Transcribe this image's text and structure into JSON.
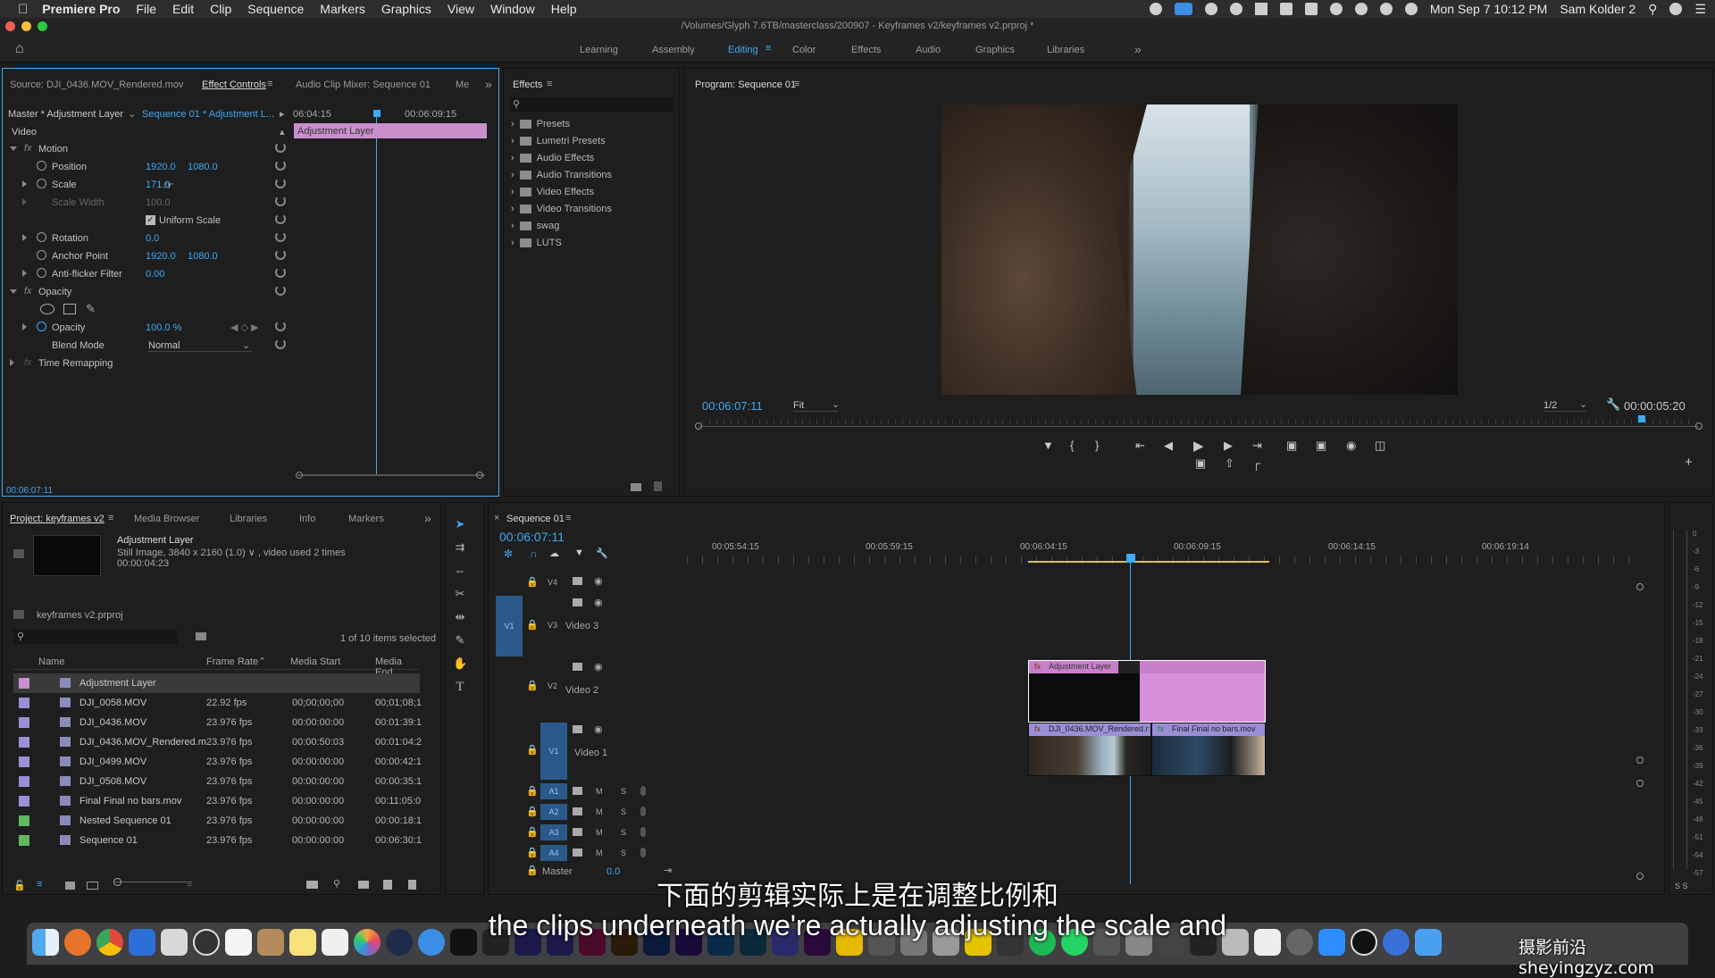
{
  "menubar": {
    "apple": "",
    "app": "Premiere Pro",
    "items": [
      "File",
      "Edit",
      "Clip",
      "Sequence",
      "Markers",
      "Graphics",
      "View",
      "Window",
      "Help"
    ],
    "clock": "Mon Sep 7  10:12 PM",
    "user": "Sam Kolder 2"
  },
  "title": "/Volumes/Glyph 7.6TB/masterclass/200907 - Keyframes v2/keyframes v2.prproj *",
  "workspaces": [
    "Learning",
    "Assembly",
    "Editing",
    "Color",
    "Effects",
    "Audio",
    "Graphics",
    "Libraries"
  ],
  "workspace_more": "»",
  "source_tabs": {
    "source": "Source: DJI_0436.MOV_Rendered.mov",
    "effect_controls": "Effect Controls",
    "mixer": "Audio Clip Mixer: Sequence 01",
    "metadata": "Me",
    "more": "»"
  },
  "effect_controls": {
    "master": "Master * Adjustment Layer",
    "sequence": "Sequence 01 * Adjustment L...",
    "t1": "06:04:15",
    "t2": "00:06:09:15",
    "clip_label": "Adjustment Layer",
    "video": "Video",
    "motion": "Motion",
    "position": "Position",
    "pos_x": "1920.0",
    "pos_y": "1080.0",
    "scale": "Scale",
    "scale_val": "171.0",
    "scale_width": "Scale Width",
    "scale_width_val": "100.0",
    "uniform": "Uniform Scale",
    "rotation": "Rotation",
    "rotation_val": "0.0",
    "anchor": "Anchor Point",
    "anchor_x": "1920.0",
    "anchor_y": "1080.0",
    "antiflicker": "Anti-flicker Filter",
    "antiflicker_val": "0.00",
    "opacity_group": "Opacity",
    "opacity": "Opacity",
    "opacity_val": "100.0 %",
    "blend": "Blend Mode",
    "blend_val": "Normal",
    "time_remap": "Time Remapping",
    "timecode": "00:06:07:11"
  },
  "effects": {
    "title": "Effects",
    "items": [
      "Presets",
      "Lumetri Presets",
      "Audio Effects",
      "Audio Transitions",
      "Video Effects",
      "Video Transitions",
      "swag",
      "LUTS"
    ]
  },
  "program": {
    "title": "Program: Sequence 01",
    "timecode": "00:06:07:11",
    "fit": "Fit",
    "res": "1/2",
    "duration": "00:00:05:20"
  },
  "project": {
    "tabs": [
      "Project: keyframes v2",
      "Media Browser",
      "Libraries",
      "Info",
      "Markers"
    ],
    "more": "»",
    "item_name": "Adjustment Layer",
    "item_info": "Still Image, 3840 x 2160 (1.0) ∨ , video used 2 times",
    "item_dur": "00:00:04:23",
    "file": "keyframes v2.prproj",
    "selected": "1 of 10 items selected",
    "cols": [
      "Name",
      "Frame Rate",
      "Media Start",
      "Media End"
    ],
    "rows": [
      {
        "name": "Adjustment Layer",
        "fps": "",
        "start": "",
        "end": "",
        "color": "#c98fcd"
      },
      {
        "name": "DJI_0058.MOV",
        "fps": "22.92 fps",
        "start": "00;00;00;00",
        "end": "00;01;08;1",
        "color": "#9a8fd6"
      },
      {
        "name": "DJI_0436.MOV",
        "fps": "23.976 fps",
        "start": "00:00:00:00",
        "end": "00:01:39:1",
        "color": "#9a8fd6"
      },
      {
        "name": "DJI_0436.MOV_Rendered.m",
        "fps": "23.976 fps",
        "start": "00:00:50:03",
        "end": "00:01:04:2",
        "color": "#9a8fd6"
      },
      {
        "name": "DJI_0499.MOV",
        "fps": "23.976 fps",
        "start": "00:00:00:00",
        "end": "00:00:42:1",
        "color": "#9a8fd6"
      },
      {
        "name": "DJI_0508.MOV",
        "fps": "23.976 fps",
        "start": "00:00:00:00",
        "end": "00:00:35:1",
        "color": "#9a8fd6"
      },
      {
        "name": "Final Final no bars.mov",
        "fps": "23.976 fps",
        "start": "00:00:00:00",
        "end": "00:11:05:0",
        "color": "#9a8fd6"
      },
      {
        "name": "Nested Sequence 01",
        "fps": "23.976 fps",
        "start": "00:00:00:00",
        "end": "00:00:18:1",
        "color": "#5fb760"
      },
      {
        "name": "Sequence 01",
        "fps": "23.976 fps",
        "start": "00:00:00:00",
        "end": "00:06:30:1",
        "color": "#5fb760"
      }
    ]
  },
  "timeline": {
    "tab": "Sequence 01",
    "timecode": "00:06:07:11",
    "ruler": [
      "00:05:54:15",
      "00:05:59:15",
      "00:06:04:15",
      "00:06:09:15",
      "00:06:14:15",
      "00:06:19:14"
    ],
    "tracks": {
      "v4": "V4",
      "v3": "V3",
      "v3name": "Video 3",
      "v2": "V2",
      "v2name": "Video 2",
      "v1": "V1",
      "v1name": "Video 1",
      "src_v1": "V1",
      "a1": "A1",
      "a2": "A2",
      "a3": "A3",
      "a4": "A4",
      "master": "Master",
      "master_val": "0.0",
      "m": "M",
      "s": "S"
    },
    "clip_adj": "Adjustment Layer",
    "clip_dji": "DJI_0436.MOV_Rendered.m",
    "clip_final": "Final Final no bars.mov"
  },
  "meter": [
    "0",
    "-3",
    "-6",
    "-9",
    "-12",
    "-15",
    "-18",
    "-21",
    "-24",
    "-27",
    "-30",
    "-33",
    "-36",
    "-39",
    "-42",
    "-45",
    "-48",
    "-51",
    "-54",
    "-57"
  ],
  "meter_foot": "S  S",
  "subtitles": {
    "cn": "下面的剪辑实际上是在调整比例和",
    "en": "the clips underneath we're actually adjusting the scale and"
  },
  "watermark": "摄影前沿 sheyingzyz.com"
}
